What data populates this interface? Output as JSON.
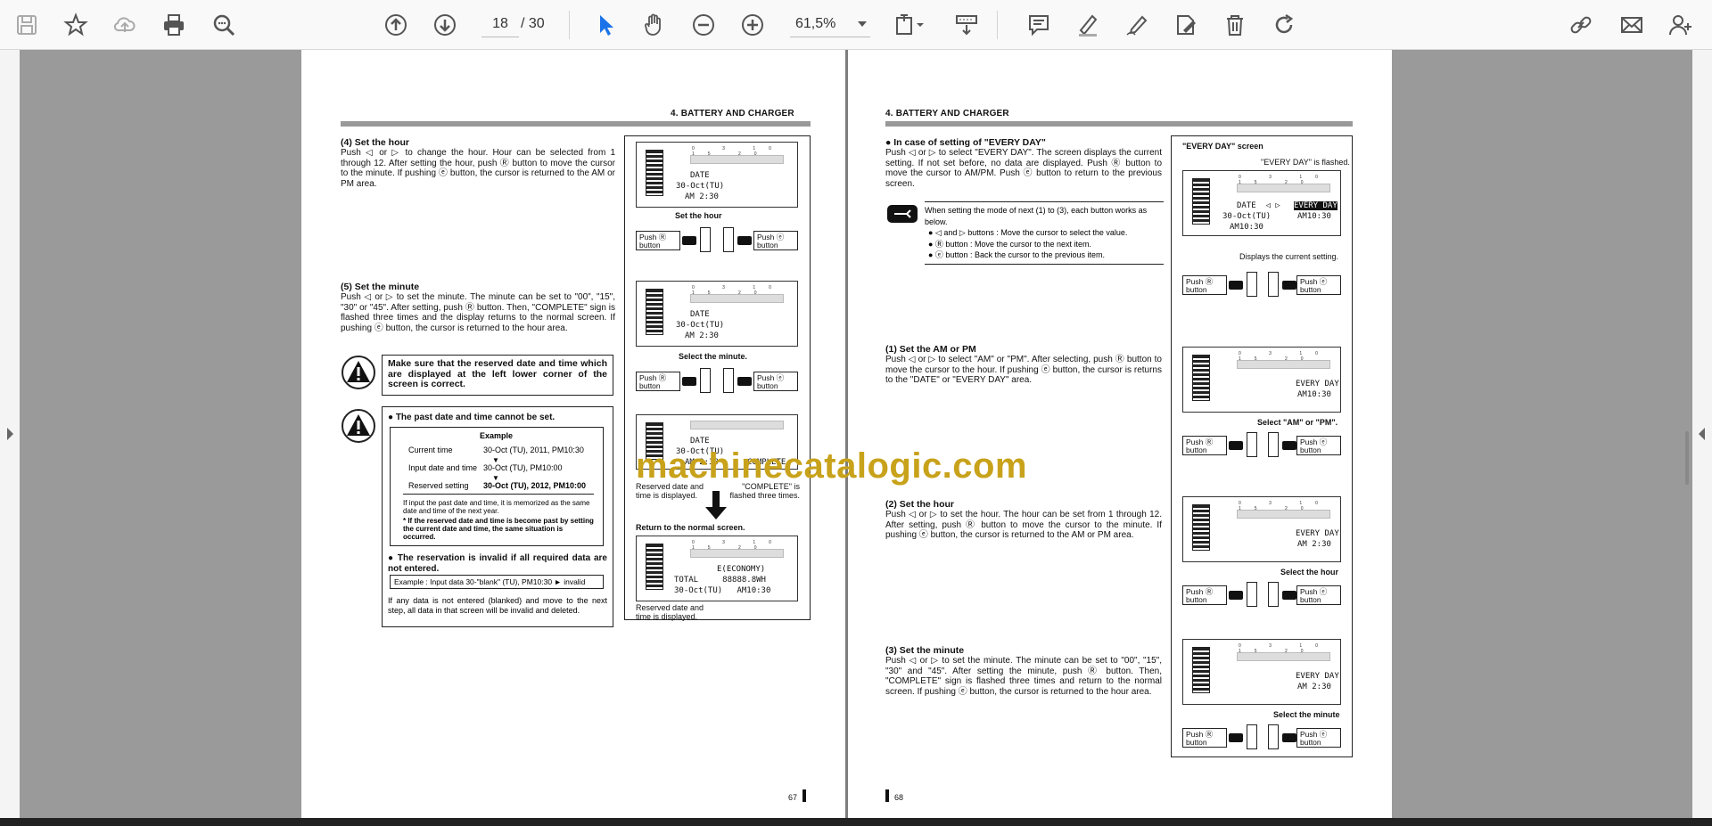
{
  "toolbar": {
    "page_current": "18",
    "page_total": "/ 30",
    "zoom": "61,5%"
  },
  "watermark": "machinecatalogic.com",
  "left_page": {
    "header": "4. BATTERY AND CHARGER",
    "sec4_title": "(4) Set the hour",
    "sec4_body": "Push ◁ or ▷ to change the hour. Hour can be selected from 1 through 12. After setting the hour, push Ⓡ button to move the cursor to the minute. If pushing ⓔ button, the cursor is returned to the AM or PM area.",
    "sec5_title": "(5) Set the minute",
    "sec5_body": "Push ◁ or ▷ to set the minute. The minute can be set to \"00\", \"15\", \"30\" or \"45\". After setting, push Ⓡ button. Then, \"COMPLETE\" sign is flashed three times and the display returns to the normal screen. If pushing ⓔ button, the cursor is returned to the hour area.",
    "caution1": "Make sure that the reserved date and time which are displayed at the left lower corner of the screen is correct.",
    "caution2_title": "● The past date and time cannot be set.",
    "example_label": "Example",
    "example_rows": [
      {
        "label": "Current time",
        "value": "30-Oct (TU), 2011,  PM10:30"
      },
      {
        "label": "Input date and time",
        "value": "30-Oct (TU),          PM10:00"
      },
      {
        "label": "Reserved setting",
        "value": "30-Oct (TU), 2012,  PM10:00"
      }
    ],
    "example_note": "If input the past date and time, it is memorized as the same date and time of the next year.",
    "example_note2": "* If the reserved date and time is become past by setting the current date and time, the same situation is occurred.",
    "invalid_title": "● The reservation is invalid if all required data are not entered.",
    "invalid_example": "Example : Input data  30-\"blank\" (TU), PM10:30 ► invalid",
    "invalid_note": "If any data is not entered (blanked) and move to the next step, all data in that screen will be invalid and deleted.",
    "page_number": "67",
    "lcd1": {
      "line1": "DATE",
      "line2": "30-Oct(TU)",
      "line3": "AM 2:30"
    },
    "cap_set_hour": "Set the hour",
    "lcd2": {
      "line1": "DATE",
      "line2": "30-Oct(TU)",
      "line3": "AM 2:30"
    },
    "cap_select_minute": "Select the minute.",
    "lcd3": {
      "line1": "DATE",
      "line2": "30-Oct(TU)",
      "line3": "AM 2:30",
      "complete": "COMPLETE"
    },
    "cap_reserved": "Reserved date and time is displayed.",
    "cap_complete": "\"COMPLETE\" is flashed three times.",
    "cap_return": "Return to the normal screen.",
    "lcd4": {
      "line1": "E(ECONOMY)",
      "line2": "TOTAL     88888.8WH",
      "line3": "30-Oct(TU)   AM10:30"
    },
    "cap_reserved2": "Reserved date and time is displayed.",
    "push_r": "Push Ⓡ button",
    "push_e": "Push ⓔ button"
  },
  "right_page": {
    "header": "4. BATTERY AND CHARGER",
    "everyday_title": "● In case of setting of \"EVERY DAY\"",
    "everyday_body": "Push ◁ or ▷ to select \"EVERY DAY\". The screen displays the current setting. If not set before, no data are displayed. Push Ⓡ button to move the cursor to AM/PM. Push ⓔ button to return to the previous screen.",
    "note_intro": "When setting the mode of next (1) to (3), each button works as below.",
    "note_items": [
      "● ◁ and ▷ buttons : Move the cursor to select the value.",
      "● Ⓡ button : Move the cursor to the next item.",
      "● ⓔ button : Back the cursor to the previous item."
    ],
    "s1_title": "(1) Set the AM or PM",
    "s1_body": "Push ◁ or ▷ to select \"AM\" or \"PM\". After selecting, push Ⓡ button to move the cursor to the hour. If pushing ⓔ button, the cursor is returns to the \"DATE\" or \"EVERY DAY\" area.",
    "s2_title": "(2) Set the hour",
    "s2_body": "Push ◁ or ▷ to set the hour. The hour can be set from 1 through 12. After setting, push Ⓡ button to move the cursor to the minute. If pushing ⓔ button, the cursor is returned to the AM or PM area.",
    "s3_title": "(3) Set the minute",
    "s3_body": "Push ◁ or ▷ to set the minute. The minute can be set to \"00\", \"15\", \"30\" and \"45\". After setting the minute, push Ⓡ button. Then, \"COMPLETE\" sign is flashed three times and return to the normal screen. If pushing ⓔ button, the cursor is returned to the hour area.",
    "screen_title": "\"EVERY DAY\" screen",
    "cap_flashed": "\"EVERY DAY\" is flashed.",
    "lcd_a": {
      "line1": "DATE  ◁ ▷",
      "everyday": "EVERY DAY",
      "line2": "30-Oct(TU)",
      "line3": "AM10:30",
      "line4": "AM10:30"
    },
    "cap_current": "Displays the current setting.",
    "lcd_b": {
      "line1": "EVERY DAY",
      "line2": "AM10:30"
    },
    "cap_select_ampm": "Select \"AM\" or \"PM\".",
    "lcd_c": {
      "line1": "EVERY DAY",
      "line2": "AM 2:30"
    },
    "cap_select_hour": "Select the hour",
    "lcd_d": {
      "line1": "EVERY DAY",
      "line2": "AM 2:30"
    },
    "cap_select_minute": "Select the minute",
    "page_number": "68",
    "push_r": "Push Ⓡ button",
    "push_e": "Push ⓔ button"
  }
}
